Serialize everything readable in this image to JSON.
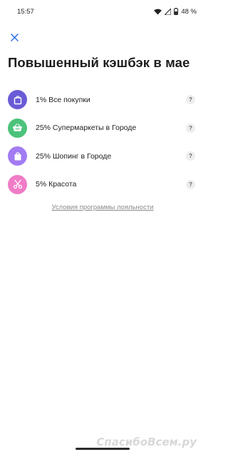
{
  "status_bar": {
    "time": "15:57",
    "battery": "48 %"
  },
  "header": {
    "title": "Повышенный кэшбэк в мае"
  },
  "categories": [
    {
      "label": "1% Все покупки",
      "icon": "shopping-bag-icon",
      "color": "#6a5bd6"
    },
    {
      "label": "25% Супермаркеты в Городе",
      "icon": "basket-icon",
      "color": "#4cc27b"
    },
    {
      "label": "25% Шопинг в Городе",
      "icon": "shopping-bag-icon",
      "color": "#a17cf2"
    },
    {
      "label": "5% Красота",
      "icon": "scissors-icon",
      "color": "#f07cc6"
    }
  ],
  "help_glyph": "?",
  "footer": {
    "terms_link": "Условия программы лояльности"
  },
  "watermark": "СпасибоВсем.ру"
}
